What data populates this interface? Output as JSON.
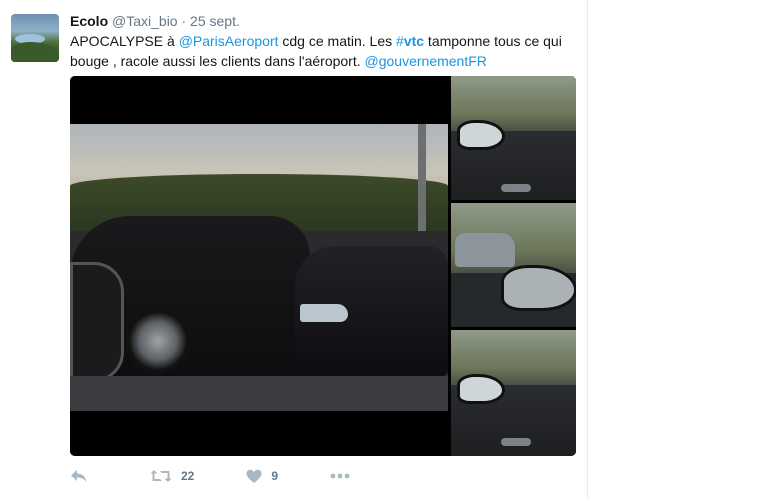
{
  "tweet": {
    "author_name": "Ecolo",
    "handle": "@Taxi_bio",
    "separator": "·",
    "date": "25 sept.",
    "text": {
      "part1": "APOCALYPSE à ",
      "mention1": "@ParisAeroport",
      "part2": " cdg ce matin. Les ",
      "hashtag_symbol": "#",
      "hashtag": "vtc",
      "part3": " tamponne tous ce qui bouge , racole aussi les clients dans l'aéroport. ",
      "mention2": "@gouvernementFR"
    },
    "actions": {
      "retweet_count": "22",
      "like_count": "9"
    }
  },
  "icons": {
    "reply": "reply-icon",
    "retweet": "retweet-icon",
    "like": "heart-icon",
    "more": "more-dots-icon"
  },
  "colors": {
    "link": "#1b95e0",
    "muted": "#657786",
    "icon": "#aab8c2"
  }
}
